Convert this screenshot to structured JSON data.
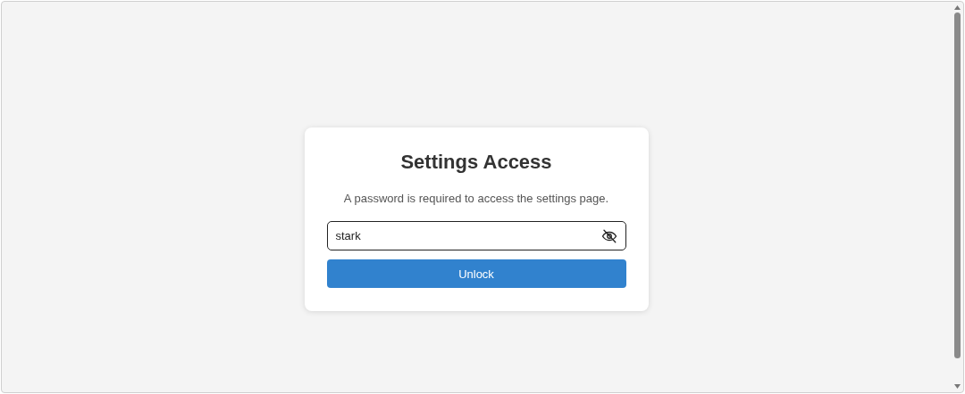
{
  "dialog": {
    "title": "Settings Access",
    "description": "A password is required to access the settings page.",
    "password_field": {
      "value": "stark"
    },
    "button": {
      "label": "Unlock"
    }
  }
}
